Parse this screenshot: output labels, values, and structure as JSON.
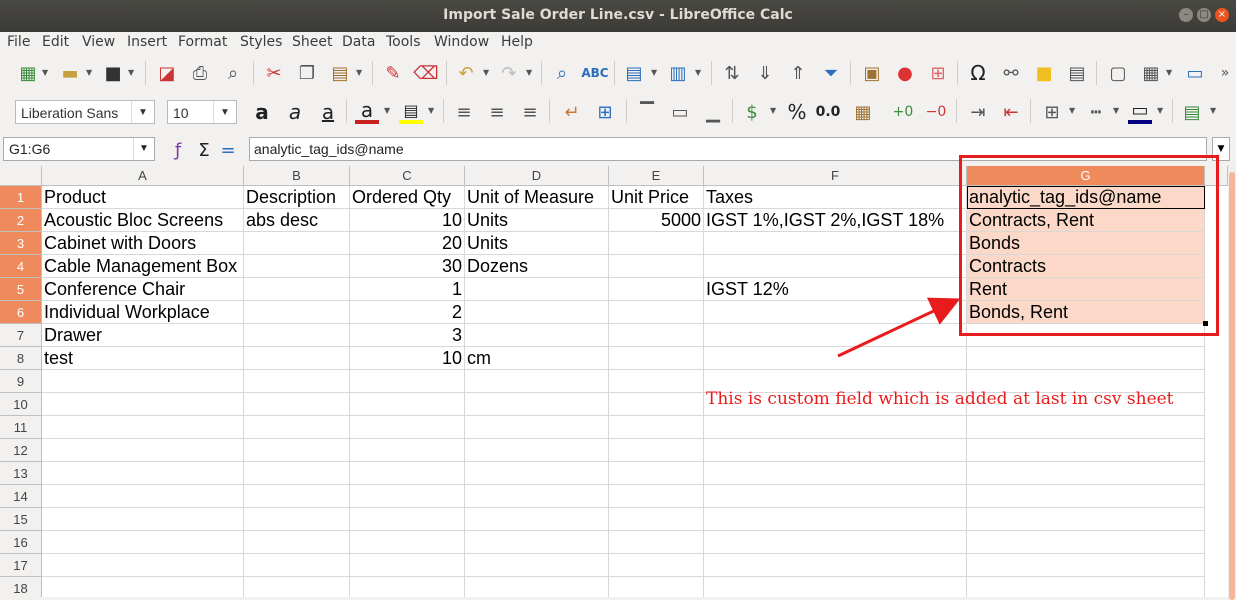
{
  "window": {
    "title": "Import Sale Order Line.csv - LibreOffice Calc"
  },
  "menu": [
    "File",
    "Edit",
    "View",
    "Insert",
    "Format",
    "Styles",
    "Sheet",
    "Data",
    "Tools",
    "Window",
    "Help"
  ],
  "toolbar": {
    "font_name": "Liberation Sans",
    "font_size": "10"
  },
  "formula": {
    "cell_ref": "G1:G6",
    "content": "analytic_tag_ids@name"
  },
  "columns": [
    "A",
    "B",
    "C",
    "D",
    "E",
    "F",
    "G"
  ],
  "rows": [
    [
      "Product",
      "Description",
      "Ordered Qty",
      "Unit of Measure",
      "Unit Price",
      "Taxes",
      "analytic_tag_ids@name"
    ],
    [
      "Acoustic Bloc Screens",
      "abs desc",
      "10",
      "Units",
      "5000",
      "IGST 1%,IGST 2%,IGST 18%",
      "Contracts, Rent"
    ],
    [
      "Cabinet with Doors",
      "",
      "20",
      "Units",
      "",
      "",
      "Bonds"
    ],
    [
      "Cable Management Box",
      "",
      "30",
      "Dozens",
      "",
      "",
      "Contracts"
    ],
    [
      "Conference Chair",
      "",
      "1",
      "",
      "",
      "IGST 12%",
      "Rent"
    ],
    [
      "Individual Workplace",
      "",
      "2",
      "",
      "",
      "",
      "Bonds, Rent"
    ],
    [
      "Drawer",
      "",
      "3",
      "",
      "",
      "",
      ""
    ],
    [
      "test",
      "",
      "10",
      "cm",
      "",
      "",
      ""
    ]
  ],
  "row_numbers": [
    "1",
    "2",
    "3",
    "4",
    "5",
    "6",
    "7",
    "8",
    "9",
    "10",
    "11",
    "12",
    "13",
    "14",
    "15",
    "16",
    "17",
    "18"
  ],
  "annotation": "This is custom field which is added at last in csv sheet",
  "colors": {
    "accent": "#e95420",
    "annotation": "#e81c1c",
    "selection": "#fbd8c8"
  }
}
